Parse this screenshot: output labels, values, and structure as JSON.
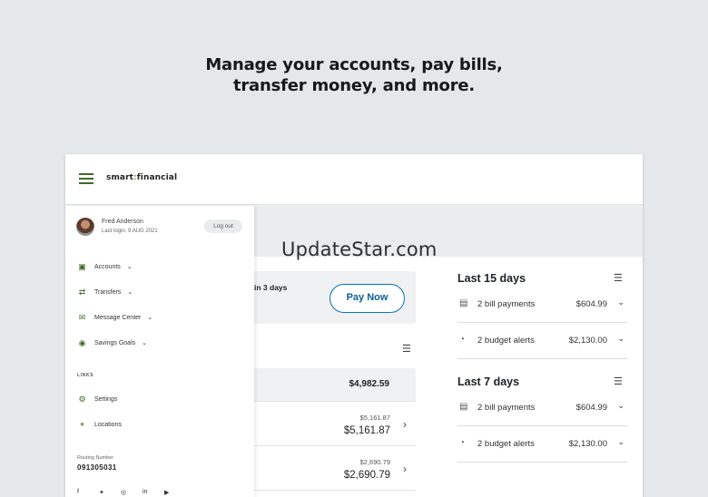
{
  "headline": [
    "Manage your accounts, pay bills,",
    "transfer money, and more."
  ],
  "app": {
    "logo_left": "smart",
    "logo_right": "financial"
  },
  "watermark": "UpdateStar.com",
  "user": {
    "name": "Fred Anderson",
    "last_login": "Last login: 9 AUG 2021",
    "logout_label": "Log out"
  },
  "nav": [
    {
      "label": "Accounts",
      "icon": "wallet-icon"
    },
    {
      "label": "Transfers",
      "icon": "transfer-icon"
    },
    {
      "label": "Message Center",
      "icon": "mail-icon"
    },
    {
      "label": "Savings Goals",
      "icon": "piggy-bank-icon"
    }
  ],
  "links": {
    "heading": "LINKS",
    "items": [
      {
        "label": "Settings",
        "icon": "gear-icon"
      },
      {
        "label": "Locations",
        "icon": "location-pin-icon"
      }
    ]
  },
  "routing": {
    "label": "Routing Number",
    "value": "091305031"
  },
  "notice": {
    "text": "in 3 days",
    "pay_label": "Pay Now"
  },
  "accounts": {
    "total": "$4,982.59",
    "rows": [
      {
        "available": "$5,161.87",
        "balance": "$5,161.87"
      },
      {
        "available": "$2,690.79",
        "balance": "$2,690.79"
      }
    ]
  },
  "summaries": [
    {
      "title": "Last 15 days",
      "rows": [
        {
          "label": "2 bill payments",
          "value": "$604.99",
          "icon": "bill-icon"
        },
        {
          "label": "2 budget alerts",
          "value": "$2,130.00",
          "icon": "pie-chart-icon"
        }
      ]
    },
    {
      "title": "Last 7 days",
      "rows": [
        {
          "label": "2 bill payments",
          "value": "$604.99",
          "icon": "bill-icon"
        },
        {
          "label": "2 budget alerts",
          "value": "$2,130.00",
          "icon": "pie-chart-icon"
        }
      ]
    }
  ],
  "colors": {
    "brand_green": "#3f6a2b",
    "pay_blue": "#0a73b8"
  }
}
